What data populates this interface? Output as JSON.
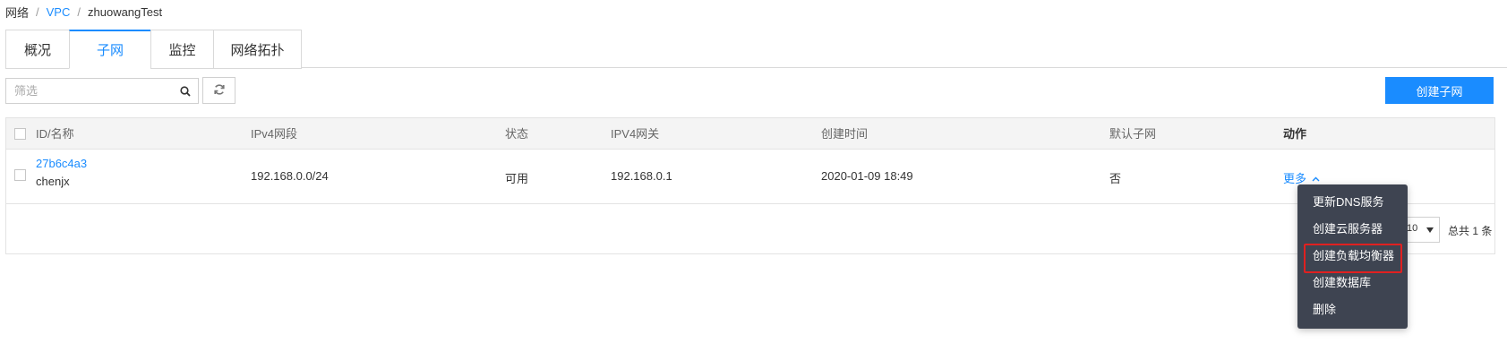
{
  "breadcrumb": {
    "root": "网络",
    "vpc": "VPC",
    "current": "zhuowangTest"
  },
  "tabs": [
    {
      "label": "概况",
      "active": false
    },
    {
      "label": "子网",
      "active": true
    },
    {
      "label": "监控",
      "active": false
    },
    {
      "label": "网络拓扑",
      "active": false
    }
  ],
  "toolbar": {
    "filter_placeholder": "筛选",
    "create_label": "创建子网"
  },
  "table": {
    "headers": [
      "ID/名称",
      "IPv4网段",
      "状态",
      "IPV4网关",
      "创建时间",
      "默认子网",
      "动作"
    ],
    "rows": [
      {
        "id": "27b6c4a3",
        "name": "chenjx",
        "cidr": "192.168.0.0/24",
        "status": "可用",
        "gateway": "192.168.0.1",
        "created": "2020-01-09 18:49",
        "default": "否",
        "action": "更多"
      }
    ]
  },
  "pagination": {
    "page_size": "10",
    "total": "总共 1 条"
  },
  "dropdown": {
    "items": [
      "更新DNS服务",
      "创建云服务器",
      "创建负载均衡器",
      "创建数据库",
      "删除"
    ],
    "highlighted_index": 2
  },
  "colors": {
    "accent": "#1a8cff",
    "dropdown_bg": "#3e4451",
    "highlight_border": "#e02020"
  },
  "icons": {
    "search": "search-icon",
    "refresh": "refresh-icon",
    "more_arrow": "chevron-up-icon",
    "select_arrow": "caret-down-icon"
  }
}
